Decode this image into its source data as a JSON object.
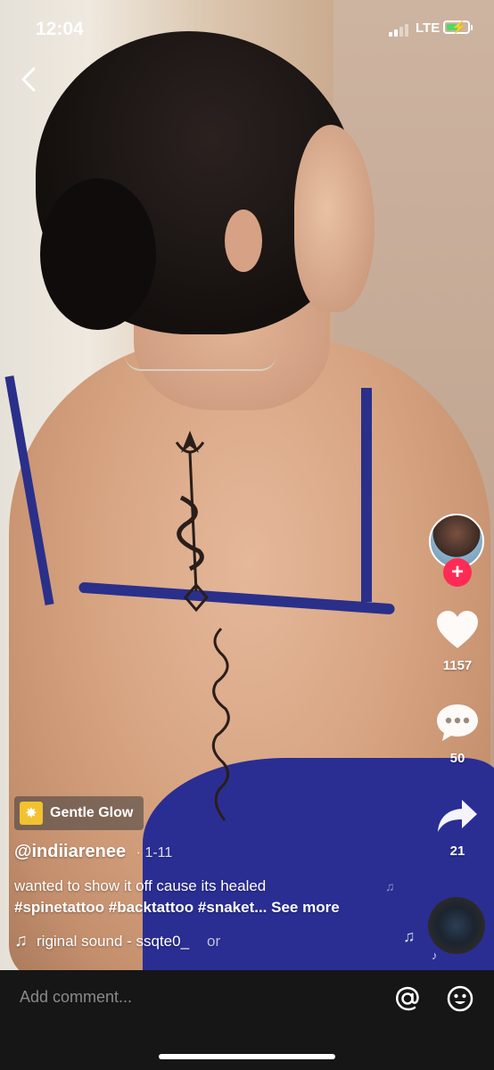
{
  "status_bar": {
    "time": "12:04",
    "network": "LTE",
    "battery_charging": true
  },
  "icons": {
    "back": "chevron-left-icon",
    "like": "heart-icon",
    "comment": "comment-bubble-icon",
    "share": "share-arrow-icon",
    "sound": "music-note-icon",
    "mention": "at-sign-icon",
    "emoji": "smiley-icon",
    "follow": "plus-icon",
    "effect": "sparkle-icon"
  },
  "rail": {
    "likes": "1157",
    "comments": "50",
    "shares": "21"
  },
  "post": {
    "effect_label": "Gentle Glow",
    "username": "@indiiarenee",
    "date": "· 1-11",
    "caption_text": "wanted to show it off cause its healed",
    "hashtags": "#spinetattoo  #backtattoo #snaket...",
    "see_more": "See more",
    "sound_text": "riginal sound - ssqte0_",
    "sound_tail": "or"
  },
  "comment_bar": {
    "placeholder": "Add comment..."
  },
  "colors": {
    "follow_red": "#fe2c55",
    "effect_yellow": "#f2c230",
    "bar_bg": "#161616"
  }
}
